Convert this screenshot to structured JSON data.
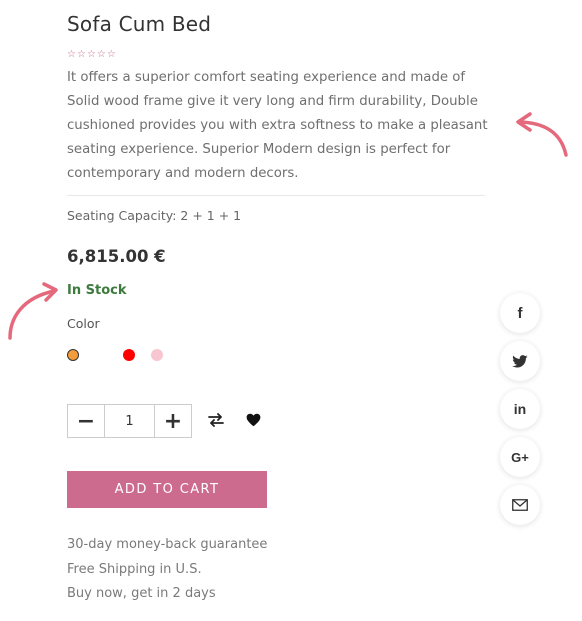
{
  "product": {
    "title": "Sofa Cum Bed",
    "rating": {
      "value": 0,
      "max": 5,
      "star_color": "#c76b8f"
    },
    "description": "It offers a superior comfort seating experience and made of Solid wood frame give it very long and firm durability, Double cushioned provides you with extra softness to make a pleasant seating experience. Superior Modern design is perfect for contemporary and modern decors.",
    "seating_capacity": "Seating Capacity: 2 + 1 + 1",
    "price": "6,815.00 €",
    "stock_status": "In Stock",
    "stock_color": "#3d7a3d",
    "color_label": "Color",
    "color_options": [
      {
        "color": "#f39c3a",
        "selected": true
      },
      {
        "color": "#ffffff",
        "selected": false
      },
      {
        "color": "#ff0000",
        "selected": false
      },
      {
        "color": "#f7c6d1",
        "selected": false
      }
    ]
  },
  "quantity": {
    "decrement": "−",
    "value": "1",
    "increment": "+"
  },
  "actions": {
    "add_to_cart": "ADD TO CART",
    "accent_color": "#cd6b8e",
    "compare_icon": "compare-icon",
    "wishlist_icon": "heart-icon"
  },
  "perks": [
    "30-day money-back guarantee",
    "Free Shipping in U.S.",
    "Buy now, get in 2 days"
  ],
  "share": [
    {
      "icon": "facebook-icon",
      "glyph": "f"
    },
    {
      "icon": "twitter-icon",
      "glyph": ""
    },
    {
      "icon": "linkedin-icon",
      "glyph": "in"
    },
    {
      "icon": "google-plus-icon",
      "glyph": "G+"
    },
    {
      "icon": "mail-icon",
      "glyph": ""
    }
  ],
  "annotation_color": "#e5697d"
}
